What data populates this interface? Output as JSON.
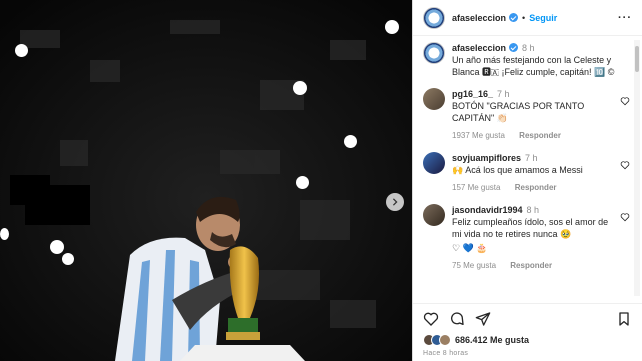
{
  "post": {
    "image_alt_icon": "photo-messi-trophy"
  },
  "header": {
    "username": "afaseleccion",
    "separator": "•",
    "follow_label": "Seguir",
    "more_label": "···"
  },
  "caption": {
    "username": "afaseleccion",
    "time": "8 h",
    "text": "Un año más festejando con la Celeste y Blanca 🆁🇦 ¡Feliz cumple, capitán! 🔟 ©"
  },
  "comments": [
    {
      "username": "pg16_16_",
      "time": "7 h",
      "text": "BOTÓN \"GRACIAS POR TANTO CAPITÁN\" 👏🏻",
      "likes": "1937 Me gusta",
      "reply": "Responder"
    },
    {
      "username": "soyjuampiflores",
      "time": "7 h",
      "text": "🙌 Acá los que amamos a Messi",
      "likes": "157 Me gusta",
      "reply": "Responder"
    },
    {
      "username": "jasondavidr1994",
      "time": "8 h",
      "text": "Feliz cumpleaños ídolo, sos el amor de mi vida no te retires nunca 🥹",
      "emojis": "♡ 💙 🎂",
      "likes": "75 Me gusta",
      "reply": "Responder"
    }
  ],
  "footer": {
    "likes_count": "686.412 Me gusta",
    "posted_ago": "Hace 8 horas"
  },
  "colors": {
    "accent": "#0095f6",
    "verified": "#3897f0",
    "muted": "#8e8e8e"
  }
}
